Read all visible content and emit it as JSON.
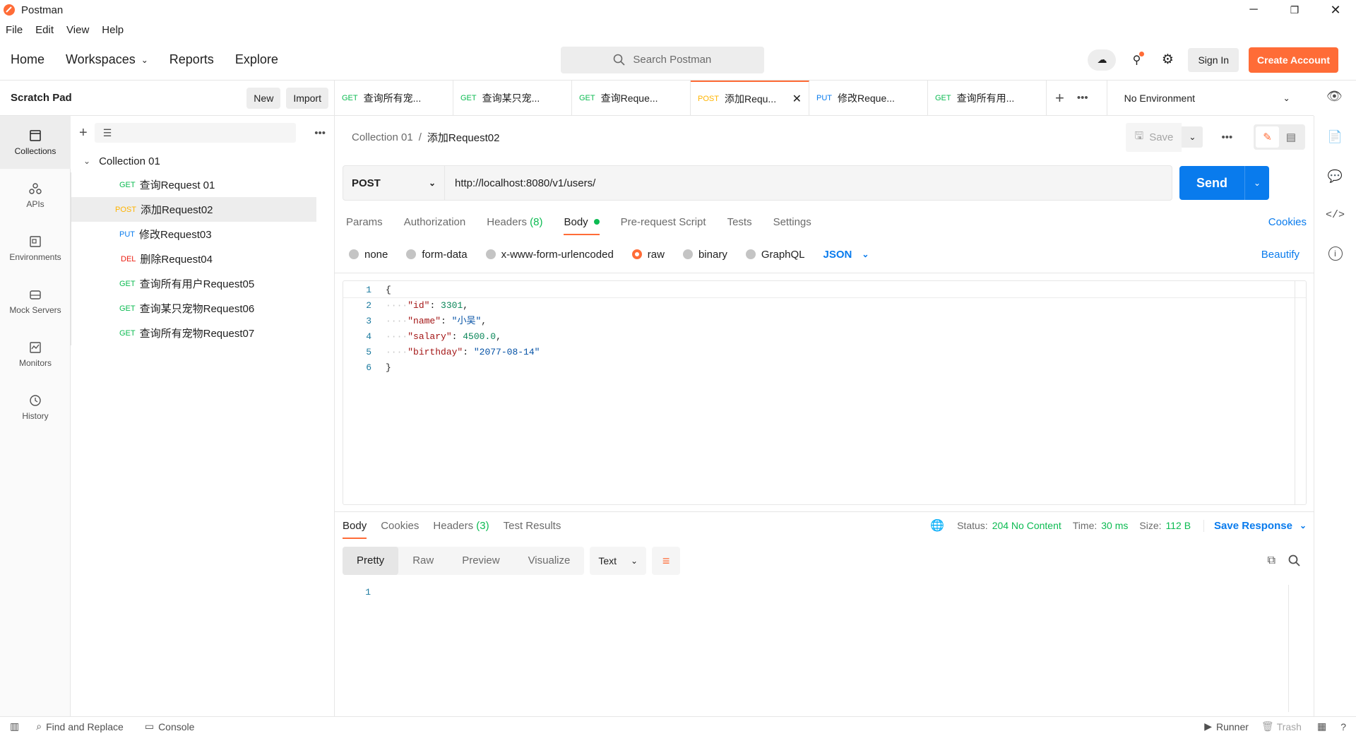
{
  "app": {
    "title": "Postman",
    "menu": [
      "File",
      "Edit",
      "View",
      "Help"
    ]
  },
  "header": {
    "nav": [
      "Home",
      "Workspaces",
      "Reports",
      "Explore"
    ],
    "search_placeholder": "Search Postman",
    "sign_in": "Sign In",
    "create_account": "Create Account"
  },
  "sidebar": {
    "title": "Scratch Pad",
    "new": "New",
    "import": "Import",
    "rail": [
      {
        "label": "Collections",
        "icon": "collections-icon"
      },
      {
        "label": "APIs",
        "icon": "apis-icon"
      },
      {
        "label": "Environments",
        "icon": "environments-icon"
      },
      {
        "label": "Mock Servers",
        "icon": "mock-servers-icon"
      },
      {
        "label": "Monitors",
        "icon": "monitors-icon"
      },
      {
        "label": "History",
        "icon": "history-icon"
      }
    ],
    "collection": "Collection 01",
    "requests": [
      {
        "method": "GET",
        "name": "查询Request 01"
      },
      {
        "method": "POST",
        "name": "添加Request02"
      },
      {
        "method": "PUT",
        "name": "修改Request03"
      },
      {
        "method": "DEL",
        "name": "删除Request04"
      },
      {
        "method": "GET",
        "name": "查询所有用户Request05"
      },
      {
        "method": "GET",
        "name": "查询某只宠物Request06"
      },
      {
        "method": "GET",
        "name": "查询所有宠物Request07"
      }
    ]
  },
  "tabs": [
    {
      "method": "GET",
      "name": "查询所有宠..."
    },
    {
      "method": "GET",
      "name": "查询某只宠..."
    },
    {
      "method": "GET",
      "name": "查询Reque..."
    },
    {
      "method": "POST",
      "name": "添加Requ..."
    },
    {
      "method": "PUT",
      "name": "修改Reque..."
    },
    {
      "method": "GET",
      "name": "查询所有用..."
    }
  ],
  "environment": "No Environment",
  "request": {
    "breadcrumb_collection": "Collection 01",
    "breadcrumb_sep": "/",
    "breadcrumb_name": "添加Request02",
    "save": "Save",
    "method": "POST",
    "url": "http://localhost:8080/v1/users/",
    "send": "Send",
    "subtabs": [
      "Params",
      "Authorization",
      "Headers",
      "Body",
      "Pre-request Script",
      "Tests",
      "Settings"
    ],
    "headers_count": "(8)",
    "cookies": "Cookies",
    "body_types": [
      "none",
      "form-data",
      "x-www-form-urlencoded",
      "raw",
      "binary",
      "GraphQL"
    ],
    "format": "JSON",
    "beautify": "Beautify",
    "code_lines": [
      "1",
      "2",
      "3",
      "4",
      "5",
      "6"
    ],
    "body": {
      "open": "{",
      "k1": "\"id\"",
      "v1": "3301",
      "k2": "\"name\"",
      "v2": "\"小吴\"",
      "k3": "\"salary\"",
      "v3": "4500.0",
      "k4": "\"birthday\"",
      "v4": "\"2077-08-14\"",
      "close": "}"
    }
  },
  "response": {
    "tabs": [
      "Body",
      "Cookies",
      "Headers",
      "Test Results"
    ],
    "headers_count": "(3)",
    "status_label": "Status:",
    "status": "204 No Content",
    "time_label": "Time:",
    "time": "30 ms",
    "size_label": "Size:",
    "size": "112 B",
    "save_response": "Save Response",
    "views": [
      "Pretty",
      "Raw",
      "Preview",
      "Visualize"
    ],
    "type": "Text",
    "line": "1"
  },
  "statusbar": {
    "find": "Find and Replace",
    "console": "Console",
    "runner": "Runner",
    "trash": "Trash"
  },
  "colors": {
    "accent": "#ff6c37",
    "send": "#097bed"
  }
}
